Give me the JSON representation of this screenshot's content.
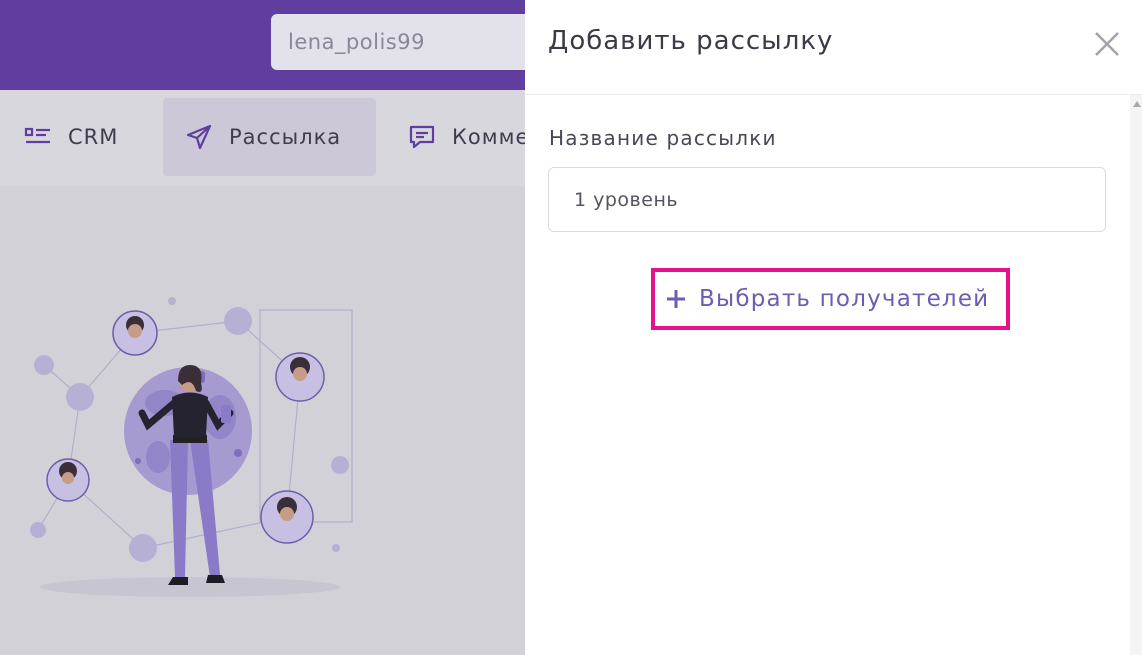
{
  "header": {
    "username": "lena_polis99"
  },
  "nav": {
    "items": [
      {
        "label": "CRM",
        "icon": "list-card-icon"
      },
      {
        "label": "Рассылка",
        "icon": "paper-plane-icon",
        "active": true
      },
      {
        "label": "Комме",
        "icon": "chat-icon"
      }
    ]
  },
  "drawer": {
    "title": "Добавить рассылку",
    "field_label": "Название рассылки",
    "name_value": "1 уровень",
    "recipients_button": "Выбрать получателей"
  },
  "colors": {
    "brand_purple": "#5f3e9f",
    "accent_text": "#6f5bb3",
    "highlight_border": "#e7128b"
  }
}
